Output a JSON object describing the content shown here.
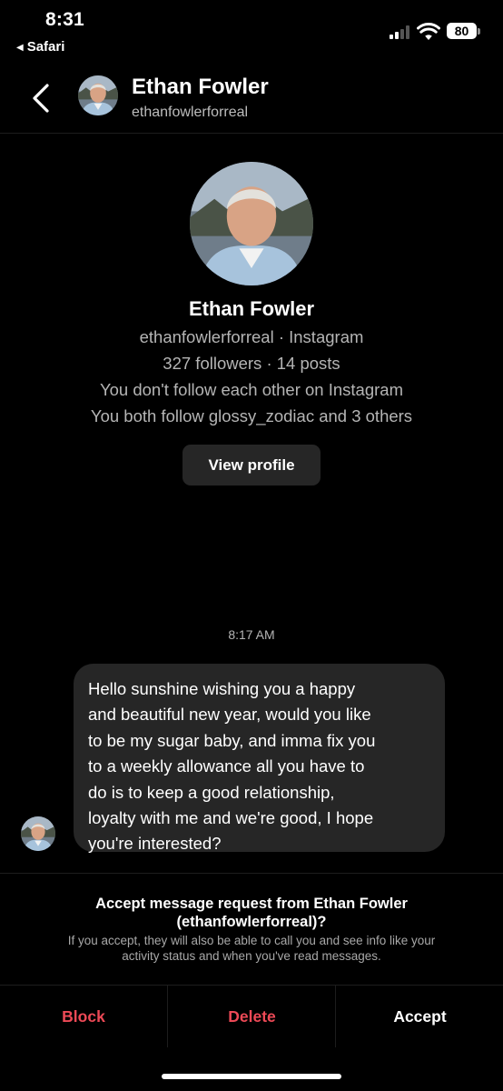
{
  "status_bar": {
    "time": "8:31",
    "back_app": "Safari",
    "battery": "80"
  },
  "header": {
    "name": "Ethan Fowler",
    "handle": "ethanfowlerforreal"
  },
  "profile": {
    "name": "Ethan Fowler",
    "handle_line": "ethanfowlerforreal · Instagram",
    "stats_line": "327 followers · 14 posts",
    "follow_line": "You don't follow each other on Instagram",
    "mutual_line": "You both follow glossy_zodiac and 3 others",
    "view_profile_label": "View profile"
  },
  "messages": [
    {
      "time": "8:17 AM",
      "text": "Hello sunshine wishing you a happy\nand beautiful new year, would you like\nto be my sugar baby, and imma fix you\nto a weekly allowance all you have to\ndo is to keep a good relationship,\nloyalty with me  and we're good, I hope\nyou're interested?"
    }
  ],
  "request": {
    "title_line1": "Accept message request from Ethan Fowler",
    "title_line2": "(ethanfowlerforreal)?",
    "subtitle_line1": "If you accept, they will also be able to call you and see info like your",
    "subtitle_line2": "activity status and when you've read messages."
  },
  "actions": {
    "block": "Block",
    "delete": "Delete",
    "accept": "Accept"
  },
  "colors": {
    "background": "#000000",
    "bubble": "#262626",
    "danger": "#ed4956",
    "muted_text": "#b5b5b5"
  }
}
